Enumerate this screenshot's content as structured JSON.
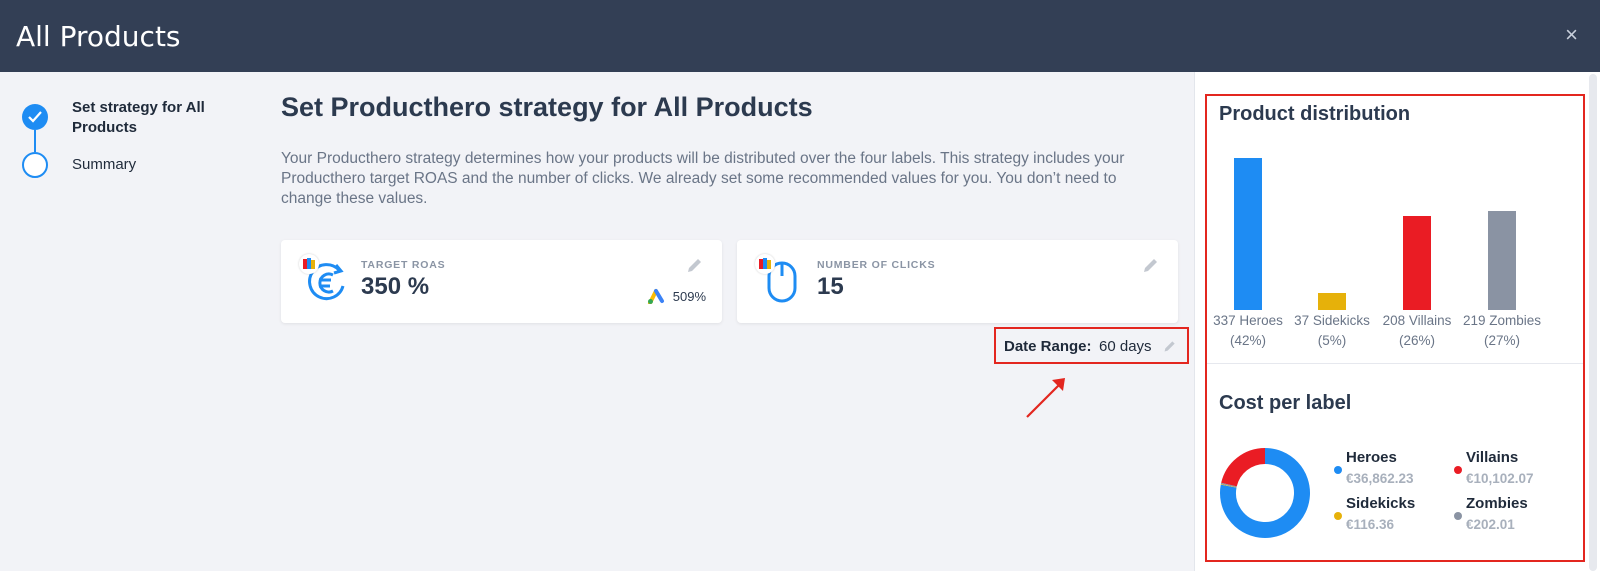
{
  "header": {
    "title": "All Products",
    "close_label": "×"
  },
  "stepper": {
    "steps": [
      {
        "label": "Set strategy for All Products",
        "status": "done"
      },
      {
        "label": "Summary",
        "status": "todo"
      }
    ]
  },
  "main": {
    "title": "Set Producthero strategy for All Products",
    "intro": "Your Producthero strategy determines how your products will be distributed over the four labels. This strategy includes your Producthero target ROAS and the number of clicks. We already set some recommended values for you. You don’t need to change these values.",
    "cards": [
      {
        "label": "TARGET ROAS",
        "value": "350 %",
        "google_ads_value": "509%",
        "icon": "euro-cycle-icon"
      },
      {
        "label": "NUMBER OF CLICKS",
        "value": "15",
        "icon": "mouse-icon"
      }
    ],
    "date_range": {
      "label": "Date Range:",
      "value": "60 days"
    }
  },
  "colors": {
    "heroes": "#1e8cf3",
    "sidekicks": "#e6b10a",
    "villains": "#ea1c24",
    "zombies": "#8a93a3",
    "highlight": "#e3261f",
    "header_bg": "#333f55"
  },
  "distribution": {
    "title": "Product distribution",
    "chart_data": {
      "type": "bar",
      "categories": [
        "Heroes",
        "Sidekicks",
        "Villains",
        "Zombies"
      ],
      "values": [
        337,
        37,
        208,
        219
      ],
      "percent": [
        42,
        5,
        26,
        27
      ],
      "labels": [
        "337 Heroes",
        "37 Sidekicks",
        "208 Villains",
        "219 Zombies"
      ],
      "percent_labels": [
        "(42%)",
        "(5%)",
        "(26%)",
        "(27%)"
      ]
    }
  },
  "cost": {
    "title": "Cost per label",
    "chart_data": {
      "type": "pie",
      "categories": [
        "Heroes",
        "Villains",
        "Sidekicks",
        "Zombies"
      ],
      "values": [
        36862.23,
        10102.07,
        116.36,
        202.01
      ],
      "amount_labels": [
        "€36,862.23",
        "€10,102.07",
        "€116.36",
        "€202.01"
      ]
    }
  }
}
